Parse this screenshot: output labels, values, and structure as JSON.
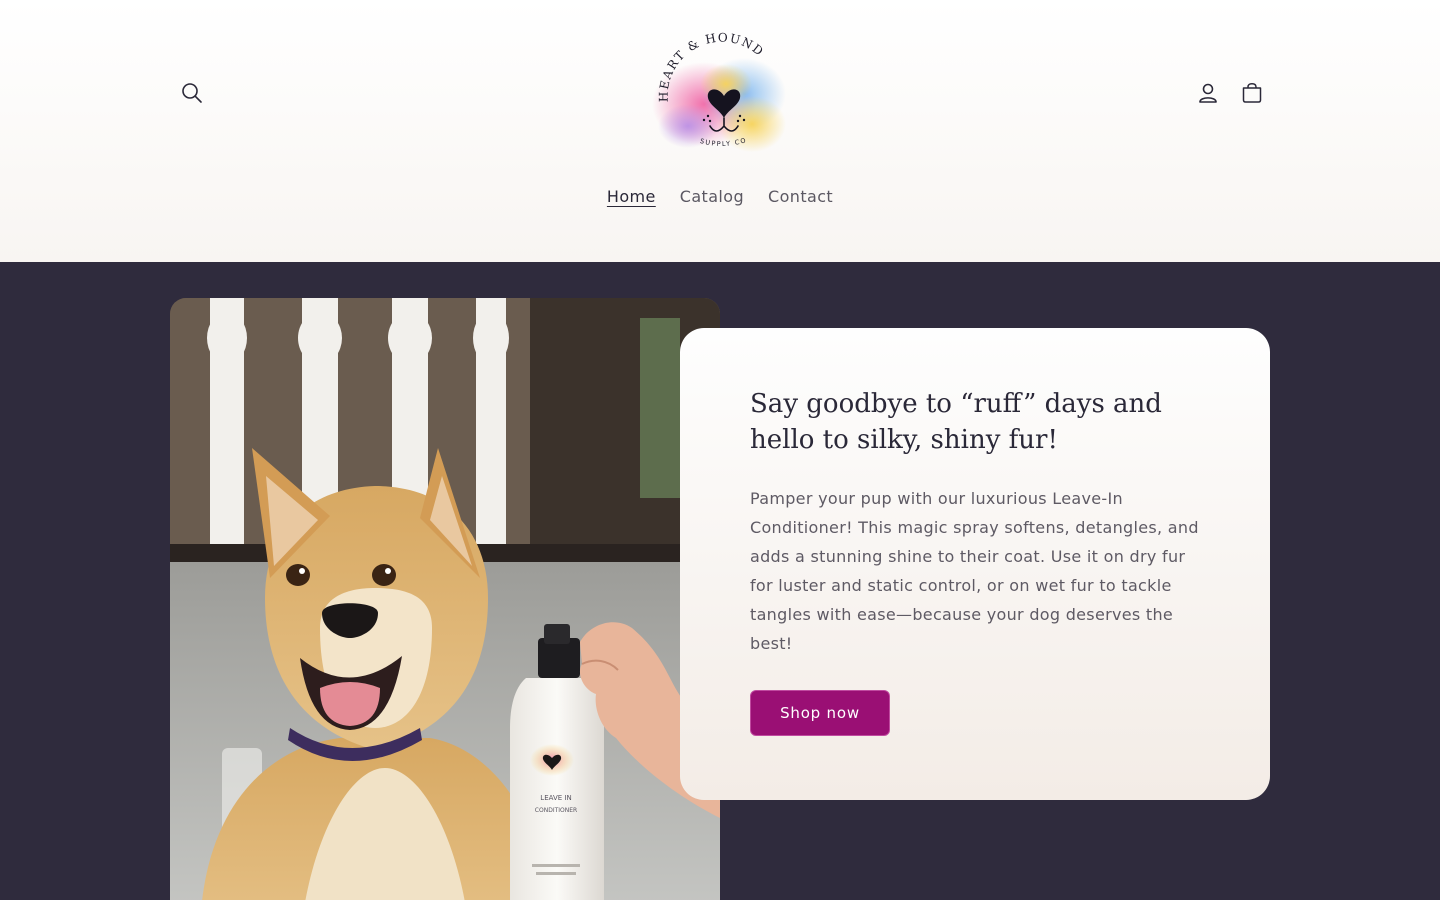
{
  "header": {
    "icons": {
      "search": "search-icon",
      "account": "account-icon",
      "cart": "cart-icon"
    },
    "logo": {
      "top_text": "HEART & HOUND",
      "bottom_text": "SUPPLY CO"
    },
    "nav": [
      {
        "label": "Home",
        "active": true
      },
      {
        "label": "Catalog",
        "active": false
      },
      {
        "label": "Contact",
        "active": false
      }
    ]
  },
  "hero": {
    "title": "Say goodbye to “ruff” days and hello to silky, shiny fur!",
    "body": "Pamper your pup with our luxurious Leave-In Conditioner! This magic spray softens, detangles, and adds a stunning shine to their coat. Use it on dry fur for luster and static control, or on wet fur to tackle tangles with ease—because your dog deserves the best!",
    "button_label": "Shop now",
    "image": {
      "bottle_line1": "LEAVE IN",
      "bottle_line2": "CONDITIONER"
    }
  },
  "colors": {
    "hero_background": "#2f2b3d",
    "button": "#9a0f74",
    "text_dark": "#2a2838",
    "text_body": "#5e5a64"
  }
}
